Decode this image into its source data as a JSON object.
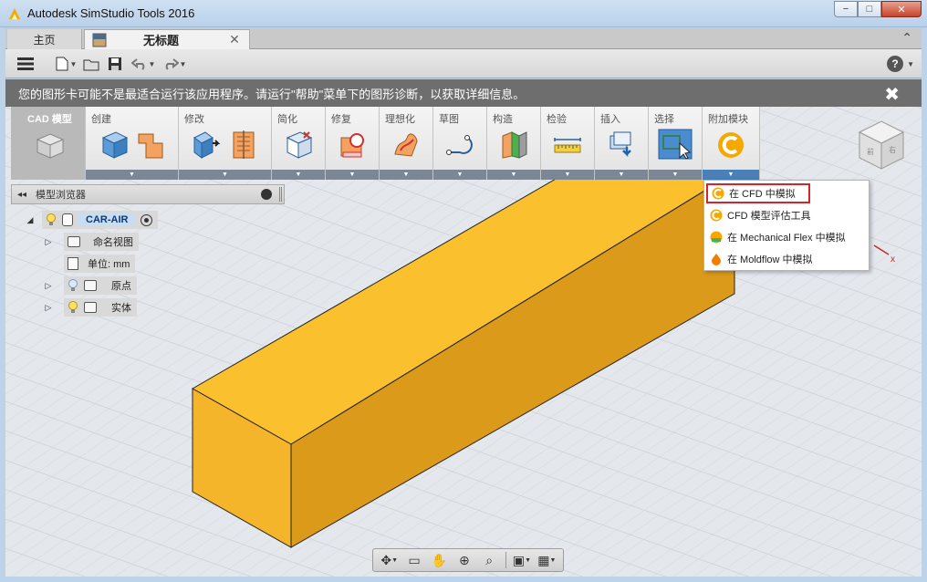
{
  "window": {
    "title": "Autodesk SimStudio Tools 2016",
    "minimize": "−",
    "maximize": "□",
    "close": "✕"
  },
  "tabs": {
    "home": "主页",
    "doc": "无标题",
    "doc_close": "✕",
    "collapse": "⌃"
  },
  "banner": {
    "text": "您的图形卡可能不是最适合运行该应用程序。请运行\"帮助\"菜单下的图形诊断，以获取详细信息。",
    "close": "✖"
  },
  "ribbon": {
    "groups": [
      {
        "label": "CAD 模型",
        "icon": "cad-model-icon"
      },
      {
        "label": "创建",
        "icon": "box-icon"
      },
      {
        "label": "修改",
        "icon": "modify-icon"
      },
      {
        "label": "简化",
        "icon": "simplify-icon"
      },
      {
        "label": "修复",
        "icon": "repair-icon"
      },
      {
        "label": "理想化",
        "icon": "idealize-icon"
      },
      {
        "label": "草图",
        "icon": "sketch-icon"
      },
      {
        "label": "构造",
        "icon": "construct-icon"
      },
      {
        "label": "检验",
        "icon": "inspect-icon"
      },
      {
        "label": "插入",
        "icon": "insert-icon"
      },
      {
        "label": "选择",
        "icon": "select-icon"
      },
      {
        "label": "附加模块",
        "icon": "addin-icon"
      }
    ],
    "caret": "▼"
  },
  "browser": {
    "title": "模型浏览器",
    "collapse_arrows": "◂◂",
    "root": "CAR-AIR",
    "items": [
      {
        "label": "命名视图",
        "icon": "folder-icon"
      },
      {
        "label": "单位: mm",
        "icon": "document-icon"
      },
      {
        "label": "原点",
        "icon": "folder-icon"
      },
      {
        "label": "实体",
        "icon": "folder-icon"
      }
    ]
  },
  "addin_menu": {
    "items": [
      {
        "label": "在 CFD 中模拟",
        "icon": "cfd-icon",
        "selected": true
      },
      {
        "label": "CFD 模型评估工具",
        "icon": "cfd-assess-icon",
        "selected": false
      },
      {
        "label": "在 Mechanical Flex 中模拟",
        "icon": "mechanical-flex-icon",
        "selected": false
      },
      {
        "label": "在 Moldflow 中模拟",
        "icon": "moldflow-icon",
        "selected": false
      }
    ]
  },
  "navbar": {
    "icons": [
      "orbit-icon",
      "look-at-icon",
      "pan-icon",
      "zoom-icon",
      "fit-icon",
      "display-settings-icon",
      "grid-icon"
    ]
  },
  "help": "?",
  "colors": {
    "accent_box": "#f9bd28",
    "banner": "#6e6e6e",
    "highlight": "#d3262b"
  }
}
